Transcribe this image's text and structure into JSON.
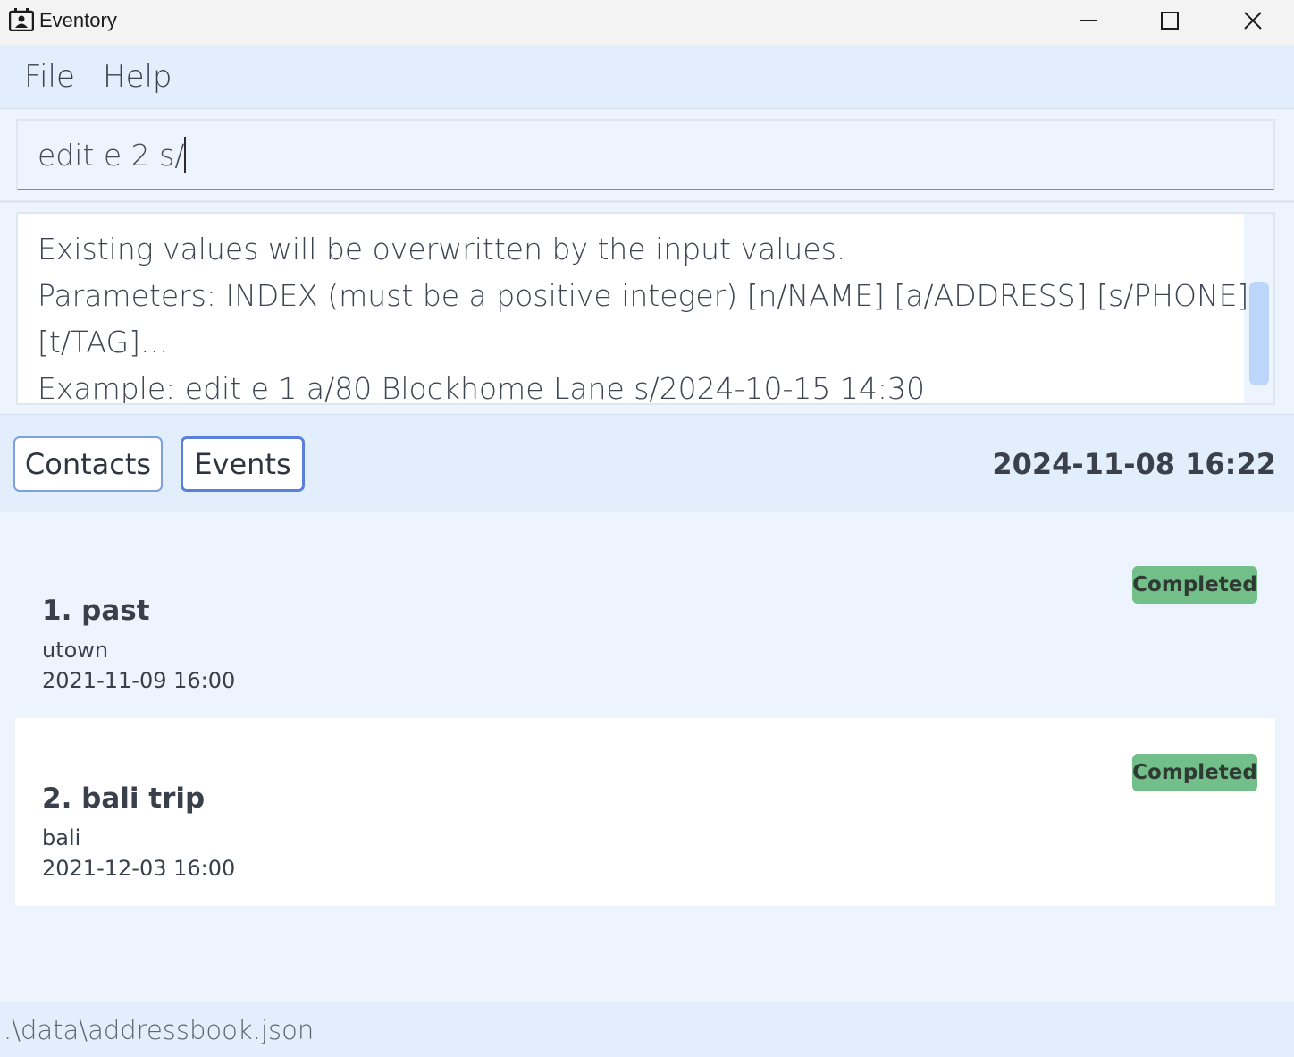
{
  "window": {
    "title": "Eventory",
    "app_icon": "calendar-contact-icon",
    "controls": [
      "minimize-icon",
      "maximize-icon",
      "close-icon"
    ]
  },
  "menu": {
    "items": [
      {
        "label": "File"
      },
      {
        "label": "Help"
      }
    ]
  },
  "command_box": {
    "value": "edit e 2 s/"
  },
  "result_display": {
    "lines": [
      "Existing values will be overwritten by the input values.",
      "Parameters: INDEX (must be a positive integer) [n/NAME] [a/ADDRESS] [s/PHONE]",
      "[t/TAG]...",
      "Example: edit e 1 a/80 Blockhome Lane s/2024-10-15 14:30"
    ]
  },
  "toolbar": {
    "contacts_label": "Contacts",
    "events_label": "Events",
    "active_tab": "Events",
    "datetime": "2024-11-08 16:22"
  },
  "events": [
    {
      "title": "1. past",
      "location": "utown",
      "datetime": "2021-11-09 16:00",
      "status": "Completed"
    },
    {
      "title": "2. bali trip",
      "location": "bali",
      "datetime": "2021-12-03 16:00",
      "status": "Completed"
    }
  ],
  "status_bar": {
    "path": ".\\data\\addressbook.json"
  },
  "colors": {
    "accent": "#5b7fdc",
    "badge_completed": "#73bf8a",
    "panel_bg": "#e2eefc",
    "list_bg": "#eef4fd"
  }
}
